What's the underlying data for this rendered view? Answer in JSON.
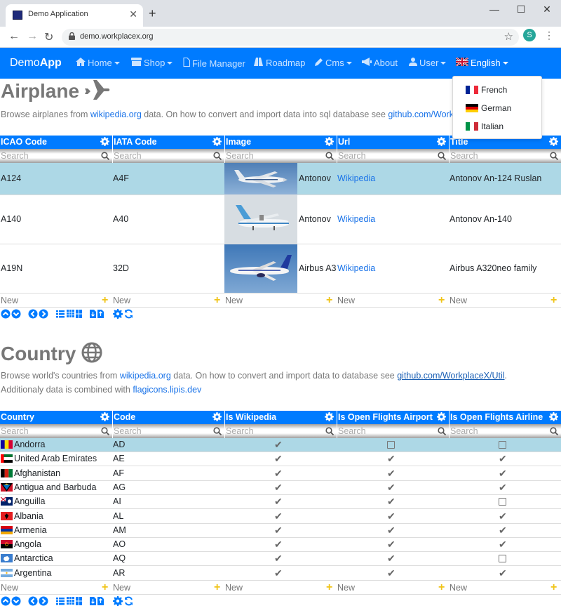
{
  "browser": {
    "tab_title": "Demo Application",
    "url": "demo.workplacex.org",
    "avatar_letter": "S"
  },
  "navbar": {
    "brand_prefix": "Demo",
    "brand_suffix": "App",
    "items": [
      {
        "label": "Home",
        "icon": "home-icon",
        "caret": true
      },
      {
        "label": "Shop",
        "icon": "shop-icon",
        "caret": true
      },
      {
        "label": "File Manager",
        "icon": "file-icon",
        "caret": false
      },
      {
        "label": "Roadmap",
        "icon": "road-icon",
        "caret": false
      },
      {
        "label": "Cms",
        "icon": "pencil-icon",
        "caret": true
      },
      {
        "label": "About",
        "icon": "megaphone-icon",
        "caret": false
      },
      {
        "label": "User",
        "icon": "user-icon",
        "caret": true
      },
      {
        "label": "English",
        "icon": "uk-flag-icon",
        "caret": true
      }
    ]
  },
  "language_dropdown": {
    "items": [
      {
        "label": "French",
        "flag": "fr"
      },
      {
        "label": "German",
        "flag": "de"
      },
      {
        "label": "Italian",
        "flag": "it"
      }
    ]
  },
  "airplane": {
    "title": "Airplane",
    "desc_pre": "Browse airplanes from ",
    "desc_link1": "wikipedia.org",
    "desc_mid": " data. On how to convert and import data into sql database see ",
    "desc_link2": "github.com/WorkplaceX/Util",
    "columns": [
      "ICAO Code",
      "IATA Code",
      "Image",
      "Url",
      "Title"
    ],
    "search_placeholder": "Search",
    "rows": [
      {
        "icao": "A124",
        "iata": "A4F",
        "maker": "Antonov",
        "url": "Wikipedia",
        "title": "Antonov An-124 Ruslan"
      },
      {
        "icao": "A140",
        "iata": "A40",
        "maker": "Antonov",
        "url": "Wikipedia",
        "title": "Antonov An-140"
      },
      {
        "icao": "A19N",
        "iata": "32D",
        "maker": "Airbus A3",
        "url": "Wikipedia",
        "title": "Airbus A320neo family"
      }
    ],
    "new_label": "New"
  },
  "country": {
    "title": "Country",
    "desc_pre": "Browse world's countries from ",
    "desc_link1": "wikipedia.org",
    "desc_mid": " data. On how to convert and import data to database see ",
    "desc_link2": "github.com/WorkplaceX/Util",
    "desc_end": ".",
    "desc2_pre": "Additionaly data is combined with ",
    "desc2_link": "flagicons.lipis.dev",
    "columns": [
      "Country",
      "Code",
      "Is Wikipedia",
      "Is Open Flights Airport",
      "Is Open Flights Airline"
    ],
    "search_placeholder": "Search",
    "rows": [
      {
        "name": "Andorra",
        "code": "AD",
        "wiki": true,
        "airport": false,
        "airline": false
      },
      {
        "name": "United Arab Emirates",
        "code": "AE",
        "wiki": true,
        "airport": true,
        "airline": true
      },
      {
        "name": "Afghanistan",
        "code": "AF",
        "wiki": true,
        "airport": true,
        "airline": true
      },
      {
        "name": "Antigua and Barbuda",
        "code": "AG",
        "wiki": true,
        "airport": true,
        "airline": true
      },
      {
        "name": "Anguilla",
        "code": "AI",
        "wiki": true,
        "airport": true,
        "airline": false
      },
      {
        "name": "Albania",
        "code": "AL",
        "wiki": true,
        "airport": true,
        "airline": true
      },
      {
        "name": "Armenia",
        "code": "AM",
        "wiki": true,
        "airport": true,
        "airline": true
      },
      {
        "name": "Angola",
        "code": "AO",
        "wiki": true,
        "airport": true,
        "airline": true
      },
      {
        "name": "Antarctica",
        "code": "AQ",
        "wiki": true,
        "airport": true,
        "airline": false
      },
      {
        "name": "Argentina",
        "code": "AR",
        "wiki": true,
        "airport": true,
        "airline": true
      }
    ],
    "new_label": "New"
  },
  "colors": {
    "primary": "#007bff",
    "selected_row": "#add8e6",
    "plus": "#f0c419"
  }
}
